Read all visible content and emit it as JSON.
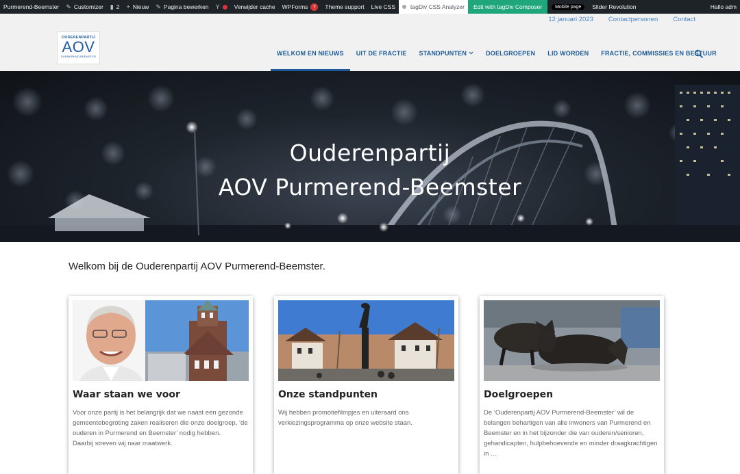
{
  "adminbar": {
    "site": "Purmerend-Beemster",
    "customizer": "Customizer",
    "comments": "2",
    "new": "Nieuw",
    "edit": "Pagina bewerken",
    "cache": "Verwijder cache",
    "wpforms": "WPForms",
    "wpforms_count": "7",
    "theme_support": "Theme support",
    "live_css": "Live CSS",
    "css_analyzer": "tagDiv CSS Analyzer",
    "composer": "Edit with tagDiv Composer",
    "mobile": "Mobile page",
    "slider": "Slider Revolution",
    "greeting": "Hallo adm"
  },
  "topbar": {
    "date": "12 januari 2023",
    "contacts": "Contactpersonen",
    "contact": "Contact"
  },
  "logo": {
    "line1": "OUDERENPARTIJ",
    "line2": "AOV",
    "line3": "PURMEREND-BEEMSTER"
  },
  "nav": {
    "items": [
      "WELKOM EN NIEUWS",
      "UIT DE FRACTIE",
      "STANDPUNTEN",
      "DOELGROEPEN",
      "LID WORDEN",
      "FRACTIE, COMMISSIES EN BESTUUR"
    ]
  },
  "hero": {
    "line1": "Ouderenpartij",
    "line2": "AOV Purmerend-Beemster"
  },
  "welcome": "Welkom bij de Ouderenpartij AOV Purmerend-Beemster.",
  "cards": [
    {
      "title": "Waar staan we voor",
      "text1": "Voor onze partij is het belangrijk dat we naast een gezonde gemeentebegroting zaken realiseren die onze doelgroep, ‘de ouderen in Purmerend en Beemster’ nodig hebben.",
      "text2": "Daarbij streven wij naar maatwerk."
    },
    {
      "title": "Onze standpunten",
      "text1": "Wij hebben promotiefilmpjes en uiteraard ons verkiezingsprogramma op onze website staan."
    },
    {
      "title": "Doelgroepen",
      "text1": "De ‘Ouderenpartij AOV Purmerend-Beemster’ wil de belangen behartigen van alle inwoners van Purmerend en Beemster en in het bijzonder die van ouderen/senioren, gehandicapten, hulpbehoevende en minder draagkrachtigen in …"
    }
  ]
}
